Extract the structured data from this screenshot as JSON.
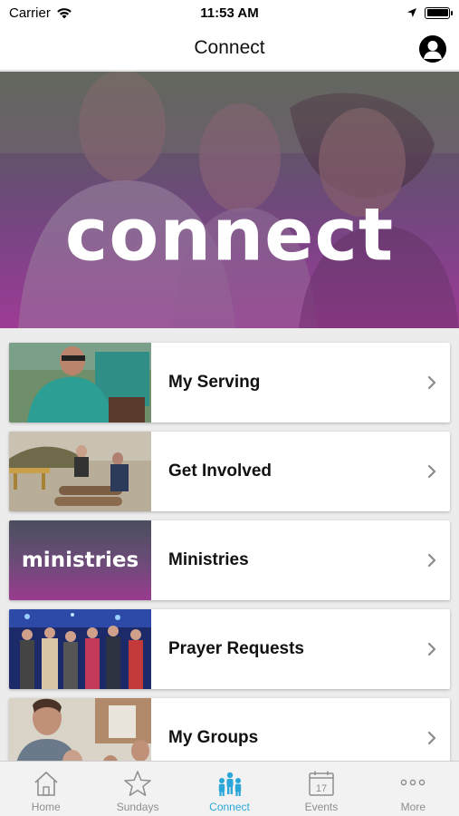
{
  "status_bar": {
    "carrier": "Carrier",
    "time": "11:53 AM"
  },
  "nav": {
    "title": "Connect"
  },
  "hero": {
    "text": "connect"
  },
  "items": [
    {
      "label": "My Serving",
      "thumb_text": ""
    },
    {
      "label": "Get Involved",
      "thumb_text": ""
    },
    {
      "label": "Ministries",
      "thumb_text": "ministries"
    },
    {
      "label": "Prayer Requests",
      "thumb_text": ""
    },
    {
      "label": "My Groups",
      "thumb_text": ""
    }
  ],
  "tabs": [
    {
      "label": "Home",
      "icon": "home-icon"
    },
    {
      "label": "Sundays",
      "icon": "star-icon"
    },
    {
      "label": "Connect",
      "icon": "people-icon",
      "active": true
    },
    {
      "label": "Events",
      "icon": "calendar-icon",
      "calendar_day": "17"
    },
    {
      "label": "More",
      "icon": "more-icon"
    }
  ],
  "colors": {
    "accent": "#2aa7d8",
    "tab_inactive": "#8e8e8e",
    "hero_purple": "#9b3a92"
  }
}
